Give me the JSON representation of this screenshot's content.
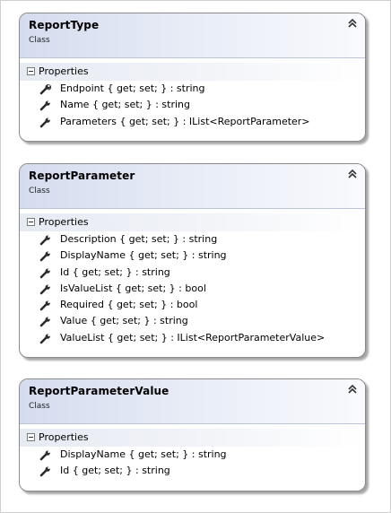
{
  "classes": [
    {
      "name": "ReportType",
      "stereotype": "Class",
      "section": "Properties",
      "members": [
        "Endpoint { get; set; } : string",
        "Name { get; set; } : string",
        "Parameters { get; set; } : IList<ReportParameter>"
      ]
    },
    {
      "name": "ReportParameter",
      "stereotype": "Class",
      "section": "Properties",
      "members": [
        "Description { get; set; } : string",
        "DisplayName { get; set; } : string",
        "Id { get; set; } : string",
        "IsValueList { get; set; } : bool",
        "Required { get; set; } : bool",
        "Value { get; set; } : string",
        "ValueList { get; set; } : IList<ReportParameterValue>"
      ]
    },
    {
      "name": "ReportParameterValue",
      "stereotype": "Class",
      "section": "Properties",
      "members": [
        "DisplayName { get; set; } : string",
        "Id { get; set; } : string"
      ]
    }
  ],
  "colors": {
    "header_gradient_start": "#d4dcee",
    "section_gradient_start": "#e6eaf3",
    "border": "#8a8a8a"
  },
  "icons": {
    "collapse": "chevron-up-double-icon",
    "section_toggle": "minus-box-icon",
    "member": "wrench-property-icon"
  }
}
